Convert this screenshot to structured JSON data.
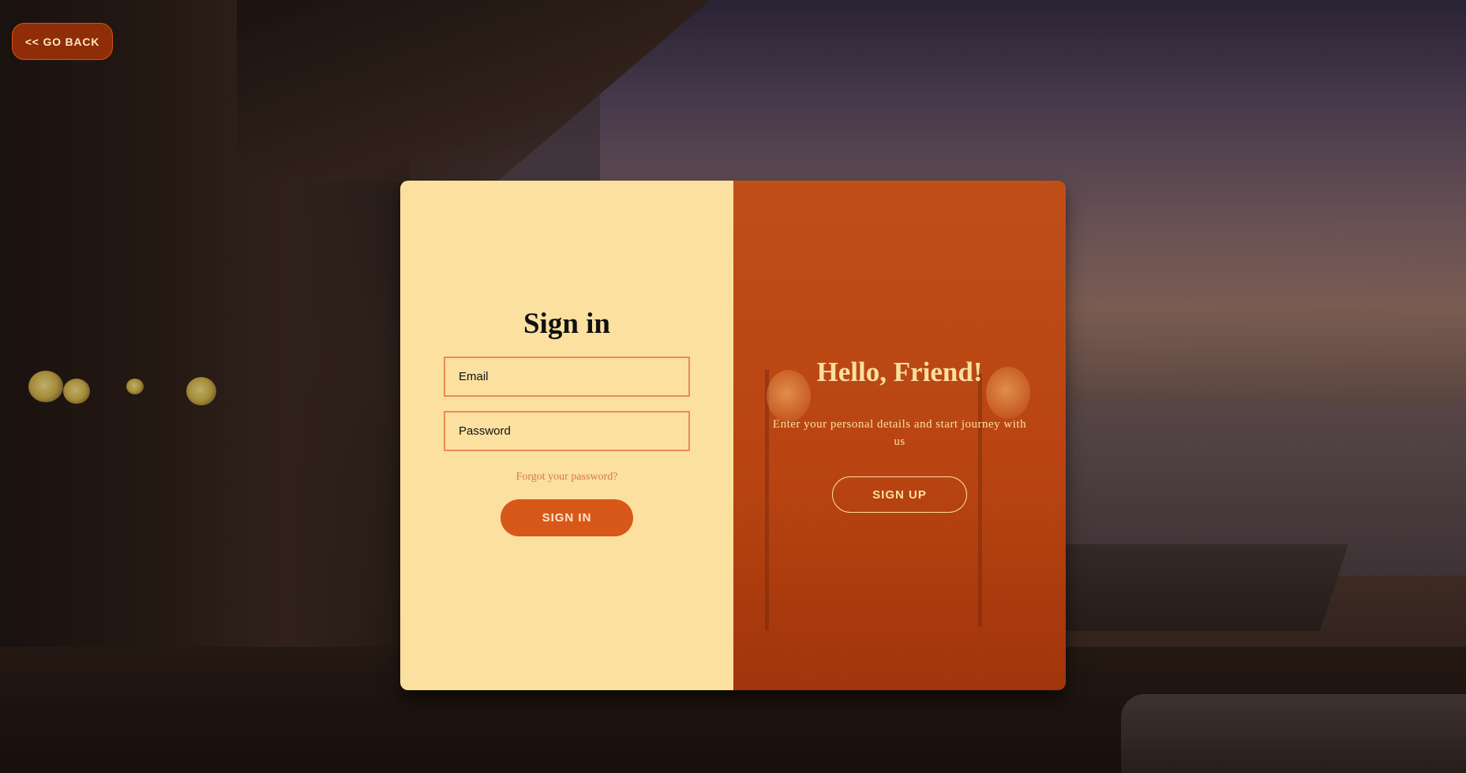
{
  "nav": {
    "back_label": "<< GO BACK"
  },
  "signin": {
    "title": "Sign in",
    "email_placeholder": "Email",
    "password_placeholder": "Password",
    "forgot_label": "Forgot your password?",
    "button_label": "SIGN IN"
  },
  "overlay": {
    "title": "Hello, Friend!",
    "text": "Enter your personal details and start journey with us",
    "button_label": "SIGN UP"
  },
  "colors": {
    "form_background": "#fbe0a0",
    "overlay_accent": "#c8501a",
    "primary_button": "#d8581a",
    "back_button": "#8e2d08",
    "field_border": "#ec8a55",
    "link": "#d4784a"
  }
}
